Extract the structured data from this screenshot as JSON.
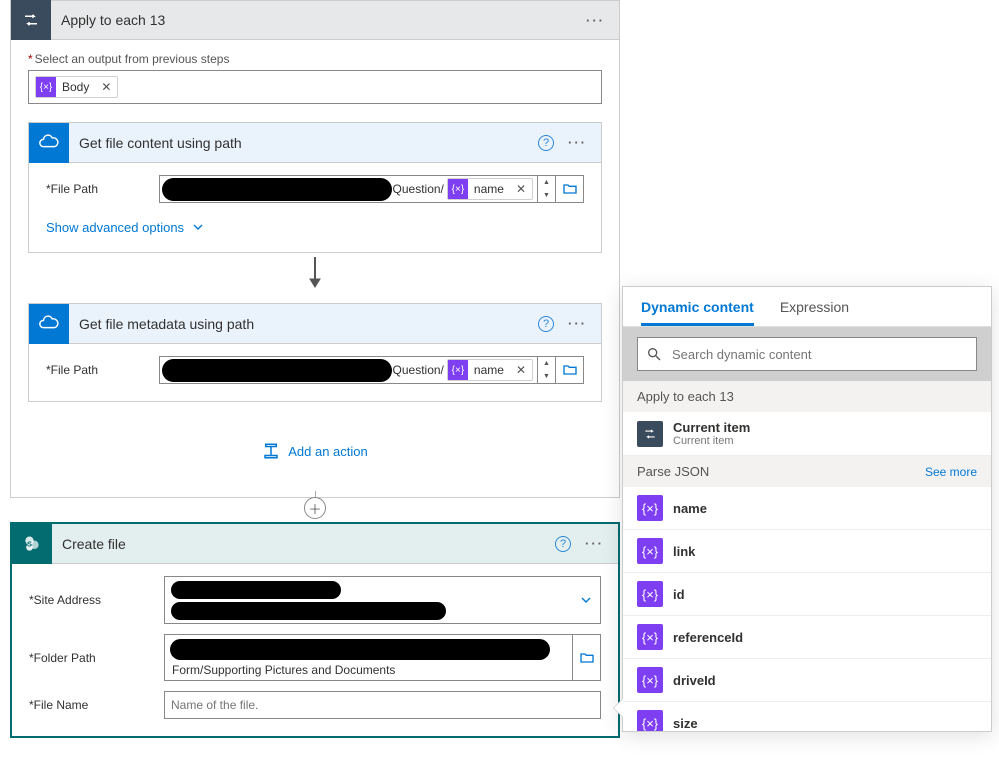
{
  "applyHeader": {
    "title": "Apply to each 13"
  },
  "selectOutput": {
    "label": "Select an output from previous steps",
    "tokenName": "Body"
  },
  "gfcPath": {
    "title": "Get file content using path",
    "fieldLabel": "File Path",
    "midText": "Question/",
    "tokenName": "name",
    "advanced": "Show advanced options"
  },
  "gfmPath": {
    "title": "Get file metadata using path",
    "fieldLabel": "File Path",
    "midText": "Question/",
    "tokenName": "name"
  },
  "addAction": "Add an action",
  "createFile": {
    "title": "Create file",
    "siteAddressLabel": "Site Address",
    "folderPathLabel": "Folder Path",
    "folderBelowText": "Form/Supporting Pictures and Documents",
    "fileNameLabel": "File Name",
    "fileNamePlaceholder": "Name of the file."
  },
  "dc": {
    "tab1": "Dynamic content",
    "tab2": "Expression",
    "searchPlaceholder": "Search dynamic content",
    "sectionApply": "Apply to each 13",
    "currentItemTitle": "Current item",
    "currentItemSub": "Current item",
    "sectionParse": "Parse JSON",
    "seeMore": "See more",
    "items": [
      "name",
      "link",
      "id",
      "referenceId",
      "driveId",
      "size"
    ]
  }
}
